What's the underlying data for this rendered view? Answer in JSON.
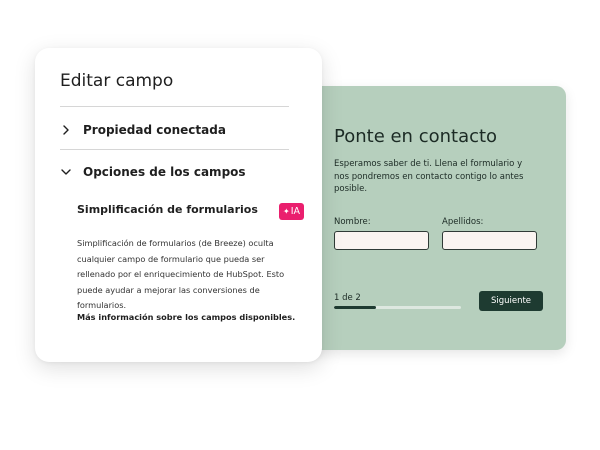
{
  "form": {
    "title": "Ponte en contacto",
    "intro": "Esperamos saber de ti. Llena el formulario y nos pondremos en contacto contigo lo antes posible.",
    "first_name_label": "Nombre:",
    "first_name_value": "",
    "last_name_label": "Apellidos:",
    "last_name_value": "",
    "step_text": "1 de 2",
    "progress": 0.33,
    "next_label": "Siguiente"
  },
  "edit_panel": {
    "title": "Editar campo",
    "sections": [
      {
        "label": "Propiedad conectada",
        "expanded": false,
        "icon": "chevron-right-icon"
      },
      {
        "label": "Opciones de los campos",
        "expanded": true,
        "icon": "chevron-down-icon"
      }
    ],
    "feature": {
      "title": "Simplificación de formularios",
      "badge": "IA",
      "badge_icon": "sparkle-icon",
      "description": "Simplificación de formularios (de Breeze) oculta cualquier campo de formulario que pueda ser rellenado por el enriquecimiento de HubSpot. Esto puede ayudar a mejorar las conversiones de formularios.",
      "learn_more": "Más información sobre los campos disponibles."
    }
  },
  "colors": {
    "form_background": "#b6cfbd",
    "primary_dark": "#1e3b31",
    "ai_badge": "#ea1f6e",
    "input_background": "#faf4f1"
  }
}
